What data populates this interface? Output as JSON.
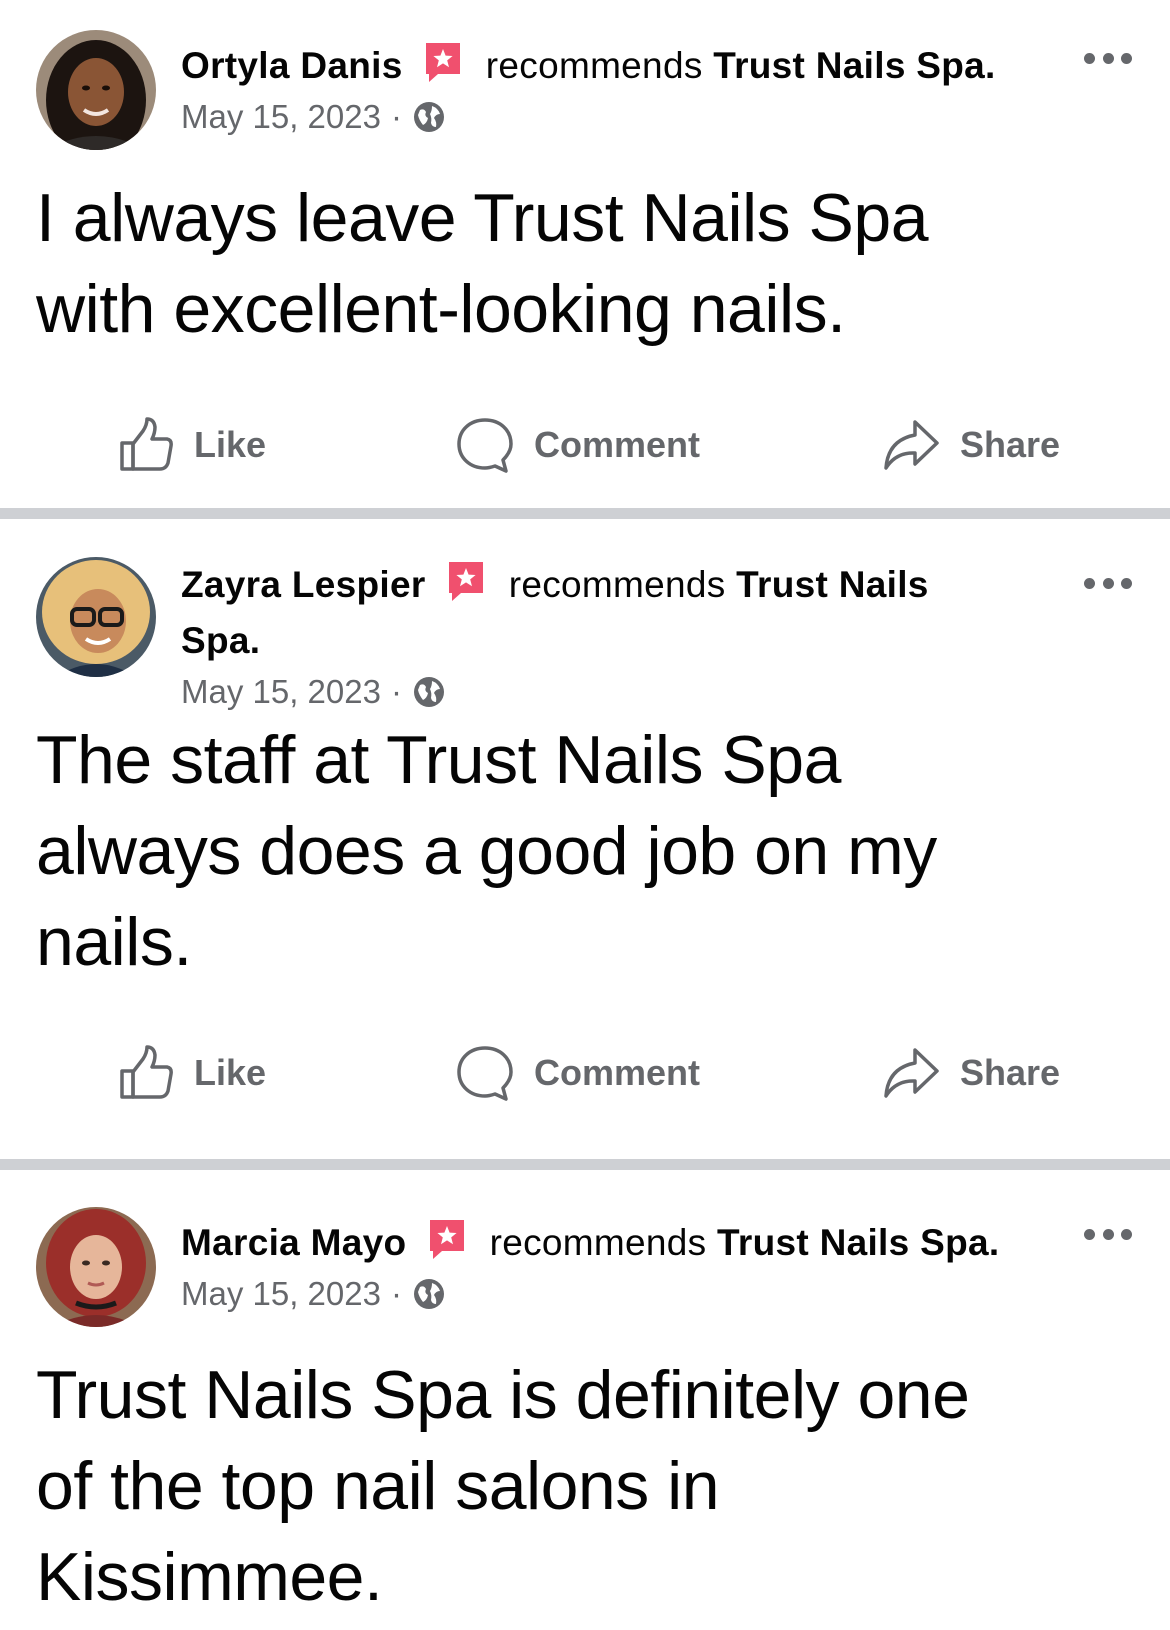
{
  "posts": [
    {
      "author": "Ortyla Danis",
      "verb": "recommends",
      "page": "Trust Nails Spa",
      "page_line1": "Trust Nails Spa.",
      "page_line2": "",
      "date": "May 15, 2023",
      "separator": "·",
      "privacy_icon": "globe-icon",
      "body_lines": [
        "I always leave Trust Nails Spa",
        "with excellent-looking nails."
      ]
    },
    {
      "author": "Zayra Lespier",
      "verb": "recommends",
      "page": "Trust Nails Spa",
      "page_line1": "Trust Nails",
      "page_line2": "Spa.",
      "date": "May 15, 2023",
      "separator": "·",
      "privacy_icon": "globe-icon",
      "body_lines": [
        "The staff at Trust Nails Spa",
        "always does a good job on my",
        "nails."
      ]
    },
    {
      "author": "Marcia Mayo",
      "verb": "recommends",
      "page": "Trust Nails Spa",
      "page_line1": "Trust Nails Spa.",
      "page_line2": "",
      "date": "May 15, 2023",
      "separator": "·",
      "privacy_icon": "globe-icon",
      "body_lines": [
        "Trust Nails Spa is definitely one",
        "of the top nail salons in",
        "Kissimmee."
      ]
    }
  ],
  "actions": {
    "like_label": "Like",
    "comment_label": "Comment",
    "share_label": "Share"
  },
  "icons": {
    "recommend_badge": "recommendation-badge-icon",
    "more": "more-options-icon",
    "like": "thumbs-up-icon",
    "comment": "comment-bubble-icon",
    "share": "share-arrow-icon"
  },
  "colors": {
    "badge": "#f0506e",
    "meta_text": "#65676b",
    "divider": "#ced0d4",
    "text": "#050505"
  }
}
